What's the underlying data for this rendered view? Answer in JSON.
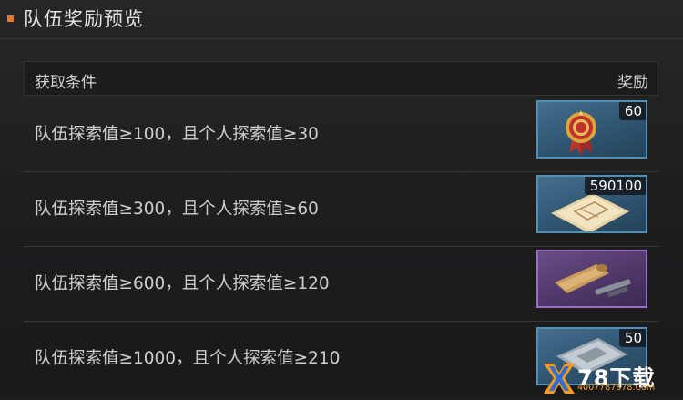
{
  "header": {
    "title": "队伍奖励预览"
  },
  "table": {
    "col_condition": "获取条件",
    "col_reward": "奖励"
  },
  "rows": [
    {
      "condition": "队伍探索值≥100，且个人探索值≥30",
      "reward_count": "60",
      "reward_icon": "medal-badge-icon",
      "rarity": "blue"
    },
    {
      "condition": "队伍探索值≥300，且个人探索值≥60",
      "reward_count": "590100",
      "reward_icon": "blueprint-paper-icon",
      "rarity": "blue"
    },
    {
      "condition": "队伍探索值≥600，且个人探索值≥120",
      "reward_count": "",
      "reward_icon": "scroll-and-tools-icon",
      "rarity": "purple"
    },
    {
      "condition": "队伍探索值≥1000，且个人探索值≥210",
      "reward_count": "50",
      "reward_icon": "silver-document-icon",
      "rarity": "blue"
    }
  ],
  "colors": {
    "accent": "#e07a2c",
    "rarity_blue": "#4f90b8",
    "rarity_purple": "#9a6dc4"
  },
  "watermark": {
    "main": "78下载",
    "sub": "4007787878.Com"
  }
}
